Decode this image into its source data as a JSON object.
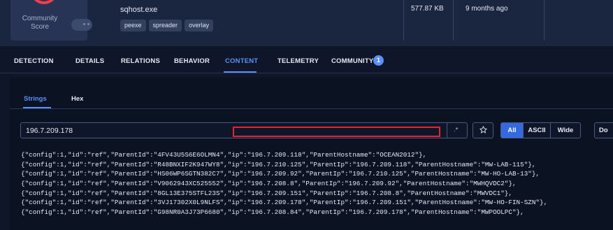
{
  "header": {
    "score_label_line1": "Community",
    "score_label_line2": "Score",
    "filename": "sqhost.exe",
    "tags": [
      "peexe",
      "spreader",
      "overlay"
    ],
    "size": "577.87 KB",
    "age": "9 months ago",
    "colors": {
      "score_ring": "#ee3f4b",
      "accent": "#5b8ff9"
    }
  },
  "tabs": [
    {
      "label": "DETECTION"
    },
    {
      "label": "DETAILS"
    },
    {
      "label": "RELATIONS"
    },
    {
      "label": "BEHAVIOR"
    },
    {
      "label": "CONTENT",
      "active": true
    },
    {
      "label": "TELEMETRY"
    },
    {
      "label": "COMMUNITY",
      "badge": "1"
    }
  ],
  "subtabs": [
    {
      "label": "Strings",
      "active": true
    },
    {
      "label": "Hex"
    }
  ],
  "search": {
    "value": "196.7.209.178"
  },
  "filters": {
    "regex_icon": "regex-icon",
    "star_icon": "star-icon",
    "segments": [
      "All",
      "ASCII",
      "Wide"
    ],
    "selected": "All",
    "cut_button": "Do"
  },
  "strings": [
    "{\"config\":1,\"id\":\"ref\",\"ParentId\":\"4FV43U5S6E6OLMN4\",\"ip\":\"196.7.209.118\",\"ParentHostname\":\"OCEAN2012\"},",
    "{\"config\":1,\"id\":\"ref\",\"ParentId\":\"R48BNXIF2K947WY8\",\"ip\":\"196.7.210.125\",\"ParentIp\":\"196.7.209.118\",\"ParentHostname\":\"MW-LAB-115\"},",
    "{\"config\":1,\"id\":\"ref\",\"ParentId\":\"HS06WP6SGTN382C7\",\"ip\":\"196.7.209.92\",\"ParentIp\":\"196.7.210.125\",\"ParentHostname\":\"MW-HO-LAB-13\"},",
    "{\"config\":1,\"id\":\"ref\",\"ParentId\":\"V9062943XC525552\",\"ip\":\"196.7.208.8\",\"ParentIp\":\"196.7.209.92\",\"ParentHostname\":\"MWHQVDC2\"},",
    "{\"config\":1,\"id\":\"ref\",\"ParentId\":\"8GL13E375STFL23S\",\"ip\":\"196.7.209.151\",\"ParentIp\":\"196.7.208.8\",\"ParentHostname\":\"MWVDC1\"},",
    "{\"config\":1,\"id\":\"ref\",\"ParentId\":\"3VJ17302X0L9NLFS\",\"ip\":\"196.7.209.178\",\"ParentIp\":\"196.7.209.151\",\"ParentHostname\":\"MW-HO-FIN-SZN\"},",
    "{\"config\":1,\"id\":\"ref\",\"ParentId\":\"G98NR0A3J73P6680\",\"ip\":\"196.7.208.84\",\"ParentIp\":\"196.7.209.178\",\"ParentHostname\":\"MWPOOLPC\"},"
  ]
}
